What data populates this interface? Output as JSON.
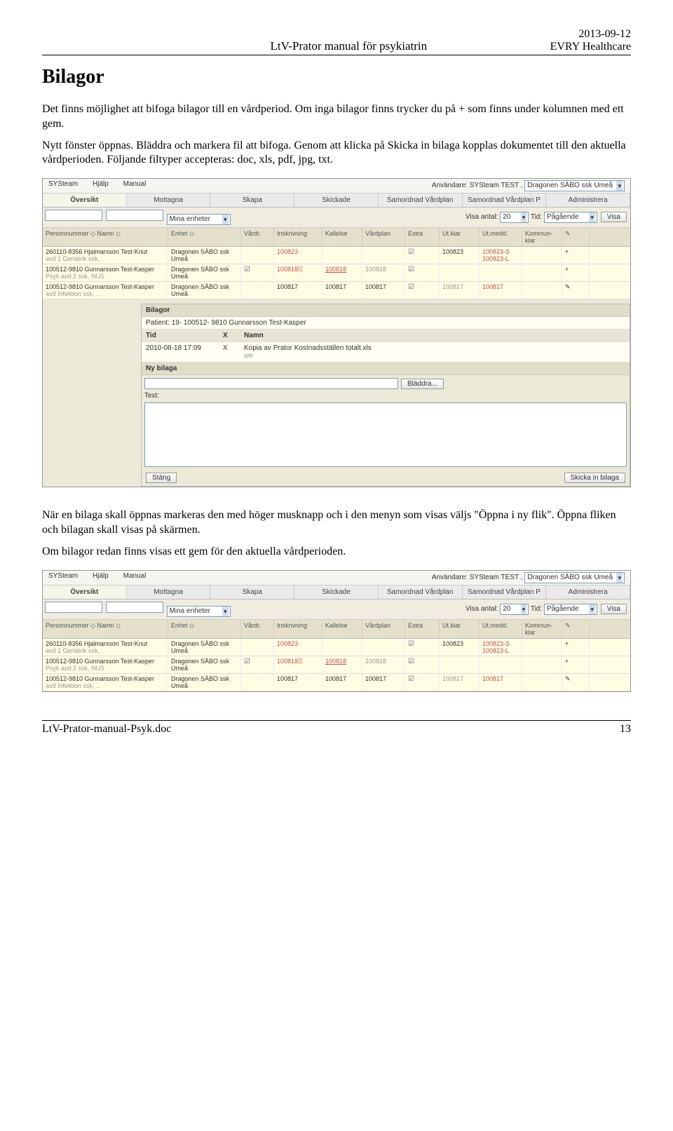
{
  "header": {
    "center": "LtV-Prator manual för psykiatrin",
    "date": "2013-09-12",
    "company": "EVRY Healthcare"
  },
  "title": "Bilagor",
  "para1": "Det finns möjlighet att bifoga bilagor till en vårdperiod. Om inga bilagor finns trycker du på + som finns under kolumnen med ett gem.",
  "para2": "Nytt fönster öppnas. Bläddra och markera fil att bifoga. Genom att klicka på Skicka in bilaga kopplas dokumentet till den aktuella vårdperioden. Följande filtyper accepteras: doc, xls, pdf, jpg, txt.",
  "para3": "När en bilaga skall öppnas markeras den med höger musknapp och i den menyn som visas väljs \"Öppna i ny flik\". Öppna fliken och bilagan skall visas på skärmen.",
  "para4": "Om bilagor redan finns visas ett gem för den aktuella vårdperioden.",
  "footer": {
    "left": "LtV-Prator-manual-Psyk.doc",
    "right": "13"
  },
  "ss": {
    "menubar": {
      "app": "SYSteam",
      "help": "Hjälp",
      "manual": "Manual",
      "userLabel": "Användare: SYSteam TEST ,",
      "unit": "Dragonen SÄBO ssk Umeå"
    },
    "tabs": [
      "Översikt",
      "Mottagna",
      "Skapa",
      "Skickade",
      "Samordnad Vårdplan",
      "Samordnad Vårdplan P",
      "Administrera"
    ],
    "filter": {
      "mina": "Mina enheter",
      "visaAntalLabel": "Visa antal:",
      "visaAntalVal": "20",
      "tidLabel": "Tid:",
      "tidVal": "Pågående",
      "visaBtn": "Visa"
    },
    "thead": [
      "Personnummer ◇  Namn ◇",
      "Enhet ◇",
      "Vårdr.",
      "Inskrivning",
      "Kallelse",
      "Vårdplan",
      "Extra",
      "Ut.klar",
      "Ut.medd.",
      "Kommun-klar",
      "✎"
    ],
    "rows": [
      {
        "person": "260110-8356 Hjalmarsson Test-Knut",
        "sub": "avd 1 Geriatrik ssk, .",
        "enhet": "Dragonen SÄBO ssk Umeå",
        "insk": "100823",
        "inskRed": true,
        "utklar": "100823",
        "utmedd1": "100823-S",
        "utmedd2": "100823-L",
        "act": "+"
      },
      {
        "person": "100512-9810 Gunnarsson Test-Kasper",
        "sub": "Psyk avd 2 ssk, NUS",
        "enhet": "Dragonen SÄBO ssk Umeå",
        "vardr": "☑",
        "insk": "100818",
        "inskRed": true,
        "inskIcon": "⎘",
        "kall": "100818",
        "kallRed": true,
        "kallU": true,
        "vardplan": "100818",
        "vpGray": true,
        "extra": "☑",
        "act": "+"
      },
      {
        "person": "100512-9810 Gunnarsson Test-Kasper",
        "sub": "avd Infektion ssk, ..",
        "enhet": "Dragonen SÄBO ssk Umeå",
        "insk": "100817",
        "kall": "100817",
        "vardplan": "100817",
        "extra": "☑",
        "utklar": "100817",
        "utklarGray": true,
        "utmedd1": "100817",
        "utmeddRed": true,
        "act": "✎"
      }
    ],
    "panel": {
      "title": "Bilagor",
      "patient": "Patient: 19- 100512- 9810  Gunnarsson Test-Kasper",
      "th_tid": "Tid",
      "th_x": "X",
      "th_namn": "Namn",
      "file_tid": "2010-08-18 17:09",
      "file_x": "X",
      "file_name": "Kopia av Prator Kostnadsställen totalt.xls",
      "file_sub": "we",
      "nybilaga": "Ny bilaga",
      "bladdra": "Bläddra...",
      "textLabel": "Text:",
      "stang": "Stäng",
      "skicka": "Skicka in bilaga"
    }
  }
}
